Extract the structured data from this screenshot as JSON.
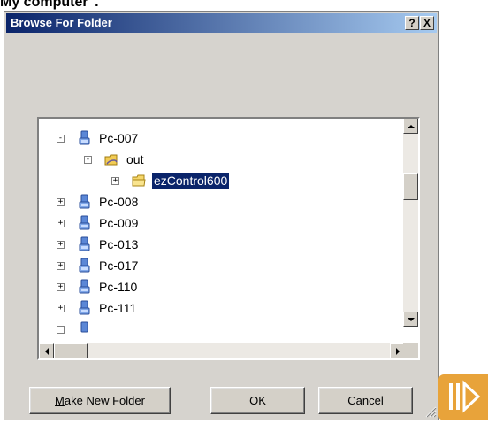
{
  "top_text": "My computer\".",
  "dialog": {
    "title": "Browse For Folder",
    "help_label": "?",
    "close_label": "X"
  },
  "tree": {
    "items": [
      {
        "label": "Pc-007",
        "expander": "-",
        "icon": "computer-icon"
      },
      {
        "label": "out",
        "expander": "-",
        "icon": "shared-folder-icon"
      },
      {
        "label": "ezControl600",
        "expander": "+",
        "icon": "folder-icon",
        "selected": true
      },
      {
        "label": "Pc-008",
        "expander": "+",
        "icon": "computer-icon"
      },
      {
        "label": "Pc-009",
        "expander": "+",
        "icon": "computer-icon"
      },
      {
        "label": "Pc-013",
        "expander": "+",
        "icon": "computer-icon"
      },
      {
        "label": "Pc-017",
        "expander": "+",
        "icon": "computer-icon"
      },
      {
        "label": "Pc-110",
        "expander": "+",
        "icon": "computer-icon"
      },
      {
        "label": "Pc-111",
        "expander": "+",
        "icon": "computer-icon"
      }
    ]
  },
  "buttons": {
    "make_new_folder_mnemonic": "M",
    "make_new_folder_rest": "ake New Folder",
    "ok": "OK",
    "cancel": "Cancel"
  },
  "colors": {
    "title_gradient_start": "#0a246a",
    "selection": "#0a246a",
    "dialog_face": "#d6d3ce",
    "logo_orange": "#e8a33a"
  }
}
